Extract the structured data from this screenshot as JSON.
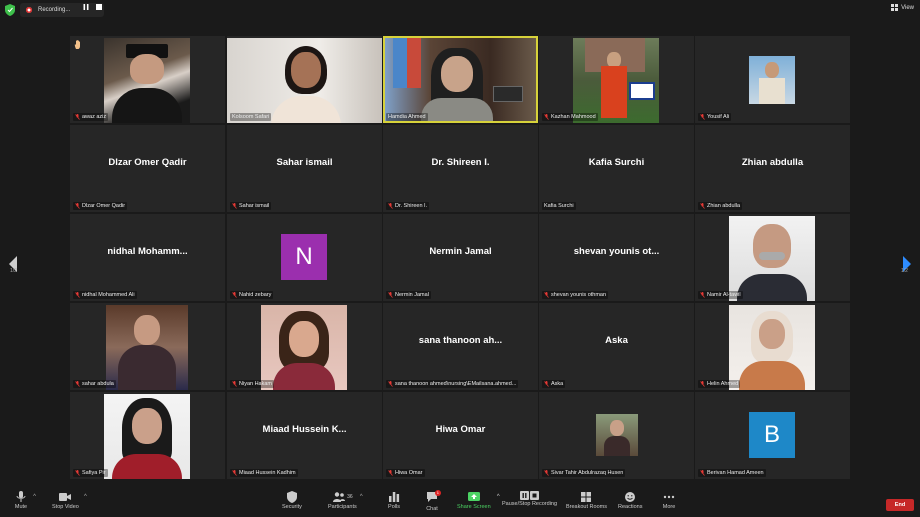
{
  "topbar": {
    "recording_label": "Recording...",
    "view_label": "View"
  },
  "navigation": {
    "page_indicator": "1/2"
  },
  "participants": [
    {
      "label": "awaz aziz",
      "muted": true,
      "kind": "photo"
    },
    {
      "label": "Kolsoom Safari",
      "muted": false,
      "kind": "photo"
    },
    {
      "label": "Hamdia Ahmed",
      "muted": false,
      "kind": "photo",
      "speaking": true
    },
    {
      "label": "Kazhan Mahmood",
      "muted": true,
      "kind": "photo"
    },
    {
      "label": "Yousif Ali",
      "muted": true,
      "kind": "photo"
    },
    {
      "display": "Dlzar Omer Qadir",
      "label": "Dlzar Omer Qadir",
      "muted": true,
      "kind": "name"
    },
    {
      "display": "Sahar ismail",
      "label": "Sahar ismail",
      "muted": true,
      "kind": "name"
    },
    {
      "display": "Dr. Shireen I.",
      "label": "Dr. Shireen I.",
      "muted": true,
      "kind": "name"
    },
    {
      "display": "Kafia Surchi",
      "label": "Kafia Surchi",
      "muted": false,
      "kind": "name"
    },
    {
      "display": "Zhian abdulla",
      "label": "Zhian abdulla",
      "muted": true,
      "kind": "name"
    },
    {
      "display": "nidhal  Mohamm...",
      "label": "nidhal Mohammed Ali",
      "muted": true,
      "kind": "name"
    },
    {
      "label": "Nahid zebary",
      "muted": true,
      "kind": "avatar",
      "initial": "N",
      "color": "#9b2fae"
    },
    {
      "display": "Nermin Jamal",
      "label": "Nermin Jamal",
      "muted": true,
      "kind": "name"
    },
    {
      "display": "shevan younis ot...",
      "label": "shevan younis othman",
      "muted": true,
      "kind": "name"
    },
    {
      "label": "Namir Al-tawil",
      "muted": true,
      "kind": "photo"
    },
    {
      "label": "sahar abdula",
      "muted": true,
      "kind": "photo"
    },
    {
      "label": "Niyan Hakam",
      "muted": true,
      "kind": "photo"
    },
    {
      "display": "sana thanoon ah...",
      "label": "sana thanoon ahmed\\nursing\\EMailsana.ahmed...",
      "muted": true,
      "kind": "name"
    },
    {
      "display": "Aska",
      "label": "Aska",
      "muted": true,
      "kind": "name"
    },
    {
      "label": "Helin Ahmed",
      "muted": true,
      "kind": "photo"
    },
    {
      "label": "Safiya Pir",
      "muted": true,
      "kind": "photo"
    },
    {
      "display": "Miaad Hussein K...",
      "label": "Miaad Hussein Kadhim",
      "muted": true,
      "kind": "name"
    },
    {
      "display": "Hiwa Omar",
      "label": "Hiwa Omar",
      "muted": true,
      "kind": "name"
    },
    {
      "label": "Sivar Tahir Abdulrazaq Husen",
      "muted": true,
      "kind": "photo"
    },
    {
      "label": "Berivan Hamad Ameen",
      "muted": true,
      "kind": "avatar",
      "initial": "B",
      "color": "#1e88c8"
    }
  ],
  "toolbar": {
    "mute": "Mute",
    "stop_video": "Stop Video",
    "security": "Security",
    "participants": "Participants",
    "participants_count": "36",
    "polls": "Polls",
    "chat": "Chat",
    "chat_badge": "1",
    "share_screen": "Share Screen",
    "pause_stop_recording": "Pause/Stop Recording",
    "breakout_rooms": "Breakout Rooms",
    "reactions": "Reactions",
    "more": "More",
    "end": "End"
  },
  "colors": {
    "background": "#1a1a1a",
    "tile": "#262626",
    "speaking_border": "#d7d23a",
    "share_green": "#4bd263",
    "end_red": "#c62828"
  }
}
